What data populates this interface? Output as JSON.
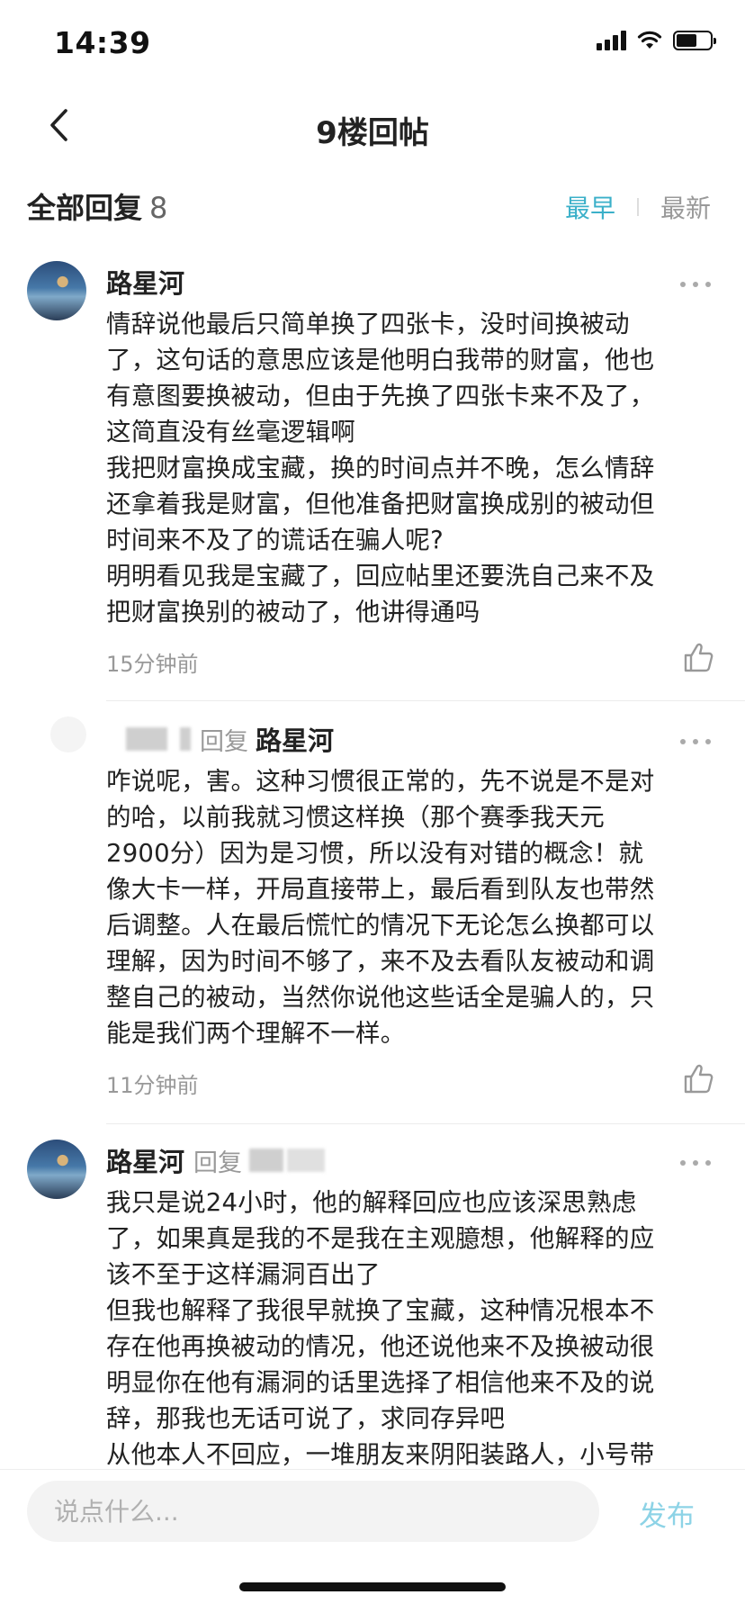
{
  "status_bar": {
    "time": "14:39"
  },
  "nav": {
    "title": "9楼回帖"
  },
  "reply_header": {
    "label": "全部回复",
    "count": "8",
    "sort_earliest": "最早",
    "sort_latest": "最新",
    "active_sort": "最早"
  },
  "comments": [
    {
      "username": "路星河",
      "reply_word": "",
      "reply_target": "",
      "text": "情辞说他最后只简单换了四张卡，没时间换被动\n了，这句话的意思应该是他明白我带的财富，他也\n有意图要换被动，但由于先换了四张卡来不及了，\n这简直没有丝毫逻辑啊\n我把财富换成宝藏，换的时间点并不晚，怎么情辞\n还拿着我是财富，但他准备把财富换成别的被动但\n时间来不及了的谎话在骗人呢?\n明明看见我是宝藏了，回应帖里还要洗自己来不及\n把财富换别的被动了，他讲得通吗",
      "time": "15分钟前"
    },
    {
      "username": "",
      "reply_word": "回复",
      "reply_target": "路星河",
      "text": "咋说呢，害。这种习惯很正常的，先不说是不是对\n的哈，以前我就习惯这样换（那个赛季我天元\n2900分）因为是习惯，所以没有对错的概念！就\n像大卡一样，开局直接带上，最后看到队友也带然\n后调整。人在最后慌忙的情况下无论怎么换都可以\n理解，因为时间不够了，来不及去看队友被动和调\n整自己的被动，当然你说他这些话全是骗人的，只\n能是我们两个理解不一样。",
      "time": "11分钟前"
    },
    {
      "username": "路星河",
      "reply_word": "回复",
      "reply_target": "",
      "text": "我只是说24小时，他的解释回应也应该深思熟虑\n了，如果真是我的不是我在主观臆想，他解释的应\n该不至于这样漏洞百出了\n但我也解释了我很早就换了宝藏，这种情况根本不\n存在他再换被动的情况，他还说他来不及换被动很\n明显你在他有漏洞的话里选择了相信他来不及的说\n辞，那我也无话可说了，求同存异吧\n从他本人不回应，一堆朋友来阴阳装路人，小号带",
      "time": ""
    }
  ],
  "input": {
    "placeholder": "说点什么...",
    "value": ""
  },
  "publish_label": "发布",
  "colors": {
    "accent": "#3bb0c9",
    "publish": "#8dd3e6",
    "muted": "#999999"
  }
}
